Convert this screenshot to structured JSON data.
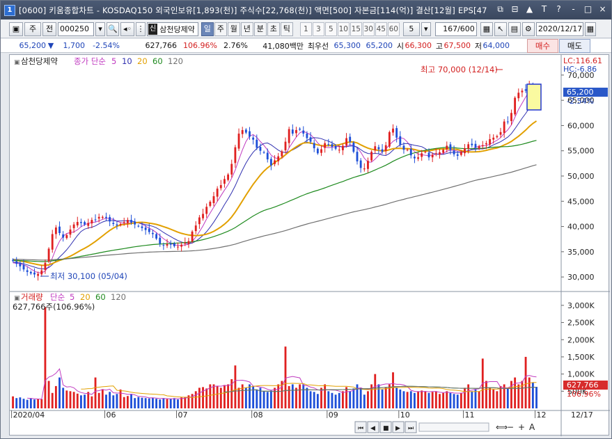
{
  "window": {
    "icon": "1",
    "title": "[0600] 키움종합차트 - KOSDAQ150 외국인보유[1,893(천)] 주식수[22,768(천)] 액면[500] 자본금[114(억)] 결산[12월] EPS[47",
    "title_buttons": [
      "⧉",
      "⊟",
      "▲",
      "T",
      "?",
      "-",
      "□",
      "×"
    ]
  },
  "toolbar": {
    "period_type": "주",
    "prev_label": "전",
    "code": "000250",
    "stock_name": "삼천당제약",
    "shin_badge": "신",
    "periods": [
      "일",
      "주",
      "월",
      "년",
      "분",
      "초",
      "틱"
    ],
    "selected_period": "일",
    "minute_values": [
      "1",
      "3",
      "5",
      "10",
      "15",
      "30",
      "45",
      "60"
    ],
    "tick_select": "5",
    "counter": "167/600",
    "date": "2020/12/17"
  },
  "quote": {
    "price": "65,200",
    "arrow": "▼",
    "change": "1,700",
    "change_pct": "-2.54%",
    "volume": "627,766",
    "volume_ratio": "106.96%",
    "turnover": "2.76%",
    "amount": "41,080백만",
    "best_label": "최우선",
    "best_ask": "65,300",
    "best_bid": "65,200",
    "open_label": "시",
    "open": "66,300",
    "high_label": "고",
    "high": "67,500",
    "low_label": "저",
    "low": "64,000",
    "buy_label": "매수",
    "sell_label": "매도"
  },
  "price_legend": {
    "name": "삼천당제약",
    "ma_label": "종가 단순",
    "ma_periods": [
      "5",
      "10",
      "20",
      "60",
      "120"
    ]
  },
  "volume_legend": {
    "name": "거래량",
    "ma_label": "단순",
    "ma_periods": [
      "5",
      "20",
      "60",
      "120"
    ],
    "info": "627,766주(106.96%)"
  },
  "readouts": {
    "lc": "LC:116.61",
    "hc": "HC:-6.86",
    "price_tag": "65,200",
    "price_tag_pct": "-2.54%",
    "volume_tag": "627,766",
    "volume_tag_pct": "106.96%"
  },
  "annotations": {
    "high": "최고 70,000 (12/14)",
    "low": "최저 30,100 (05/04)"
  },
  "date_label_right": "12/17",
  "colors": {
    "up": "#e02020",
    "down": "#1d4fd8",
    "ma5": "#c03ac0",
    "ma10": "#3030b0",
    "ma20": "#e2a000",
    "ma60": "#1e8a1e",
    "ma120": "#707070"
  },
  "chart_data": [
    {
      "type": "candlestick",
      "title": "삼천당제약",
      "x_ticks": [
        "2020/04",
        "06",
        "07",
        "08",
        "09",
        "10",
        "11",
        "12"
      ],
      "y_ticks": [
        "70,000",
        "65,000",
        "60,000",
        "55,000",
        "50,000",
        "45,000",
        "40,000",
        "35,000",
        "30,000"
      ],
      "ylim": [
        28500,
        71500
      ],
      "series": [
        {
          "name": "종가",
          "values": [
            33200,
            32600,
            32100,
            31500,
            31000,
            30700,
            30500,
            30600,
            31300,
            32800,
            35600,
            38500,
            39800,
            38700,
            37800,
            38300,
            39400,
            40400,
            40900,
            40700,
            40400,
            40700,
            41300,
            41300,
            41900,
            41900,
            41700,
            41000,
            40500,
            40200,
            40500,
            40900,
            41300,
            40800,
            40400,
            40100,
            39700,
            39300,
            38900,
            38500,
            37600,
            36600,
            36300,
            36500,
            36400,
            36100,
            36000,
            36400,
            36800,
            37100,
            39000,
            40200,
            41800,
            42500,
            43900,
            44900,
            46000,
            47500,
            48200,
            49400,
            50300,
            52400,
            55700,
            58400,
            59100,
            58600,
            57800,
            57200,
            55600,
            55000,
            54700,
            53300,
            52100,
            53100,
            53900,
            54900,
            56800,
            59300,
            58400,
            59100,
            59200,
            58400,
            57500,
            56800,
            55500,
            54500,
            55300,
            56500,
            56300,
            55800,
            55400,
            55200,
            56000,
            57500,
            56800,
            54800,
            52900,
            51600,
            51500,
            53000,
            54800,
            55900,
            55300,
            54800,
            56100,
            58700,
            59400,
            57600,
            56200,
            55200,
            55200,
            54100,
            53500,
            53700,
            54500,
            54800,
            53700,
            54200,
            54500,
            54700,
            55200,
            56000,
            55200,
            54300,
            54000,
            54800,
            55500,
            56300,
            56100,
            55600,
            55900,
            56100,
            56500,
            57300,
            57600,
            57900,
            58700,
            60800,
            60700,
            62500,
            65500,
            66500,
            66900,
            66900,
            68200,
            66900,
            65200
          ]
        },
        {
          "name": "5",
          "values": []
        },
        {
          "name": "10",
          "values": []
        },
        {
          "name": "20",
          "values": []
        },
        {
          "name": "60",
          "values": []
        },
        {
          "name": "120",
          "values": []
        }
      ]
    },
    {
      "type": "bar",
      "title": "거래량",
      "y_ticks": [
        "3,000K",
        "2,500K",
        "2,000K",
        "1,500K",
        "1,000K",
        "500K"
      ],
      "ylim": [
        0,
        3200000
      ],
      "series": [
        {
          "name": "거래량",
          "values": [
            350000,
            300000,
            320000,
            280000,
            250000,
            300000,
            260000,
            280000,
            270000,
            2950000,
            800000,
            450000,
            650000,
            900000,
            600000,
            520000,
            500000,
            480000,
            430000,
            380000,
            400000,
            480000,
            350000,
            900000,
            450000,
            560000,
            400000,
            480000,
            380000,
            420000,
            550000,
            330000,
            360000,
            420000,
            300000,
            330000,
            310000,
            300000,
            290000,
            310000,
            280000,
            260000,
            300000,
            270000,
            280000,
            300000,
            260000,
            320000,
            330000,
            380000,
            420000,
            500000,
            600000,
            620000,
            580000,
            700000,
            700000,
            650000,
            600000,
            680000,
            700000,
            850000,
            1250000,
            600000,
            700000,
            600000,
            700000,
            650000,
            550000,
            600000,
            500000,
            480000,
            520000,
            600000,
            700000,
            800000,
            1800000,
            650000,
            700000,
            600000,
            700000,
            700000,
            600000,
            500000,
            480000,
            420000,
            600000,
            700000,
            500000,
            450000,
            400000,
            450000,
            500000,
            620000,
            500000,
            580000,
            700000,
            600000,
            400000,
            500000,
            700000,
            1000000,
            700000,
            550000,
            600000,
            700000,
            1050000,
            600000,
            550000,
            500000,
            480000,
            500000,
            450000,
            500000,
            520000,
            500000,
            450000,
            480000,
            500000,
            420000,
            450000,
            500000,
            450000,
            420000,
            400000,
            450000,
            600000,
            700000,
            500000,
            550000,
            500000,
            1450000,
            800000,
            600000,
            550000,
            500000,
            650000,
            700000,
            600000,
            800000,
            900000,
            700000,
            800000,
            1500000,
            900000,
            750000,
            627766
          ]
        }
      ]
    }
  ]
}
